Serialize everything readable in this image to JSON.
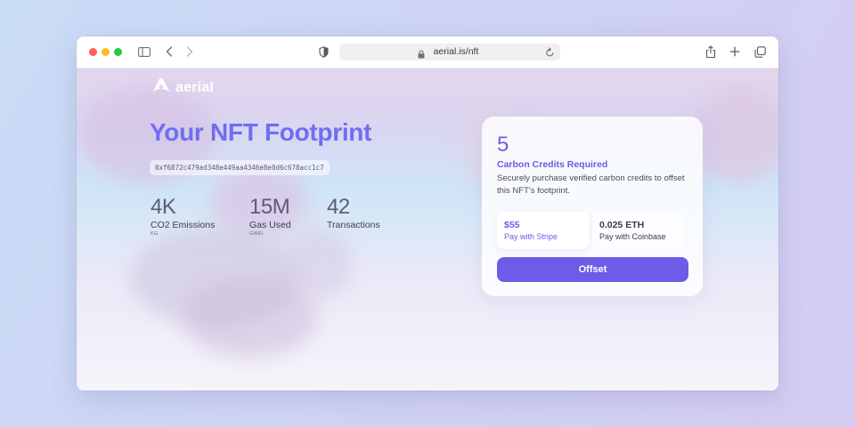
{
  "browser": {
    "url": "aerial.is/nft",
    "icons": [
      "sidebar-icon",
      "back-icon",
      "forward-icon",
      "shield-icon",
      "lock-icon",
      "reload-icon",
      "share-icon",
      "new-tab-icon",
      "tabs-icon"
    ]
  },
  "brand": {
    "name": "aerial"
  },
  "page": {
    "title": "Your NFT Footprint",
    "wallet_hash": "0xf6872c479ad348e449aa4346e8e0d6c678acc1c7",
    "stats": [
      {
        "value": "4K",
        "label": "CO2 Emissions",
        "unit": "KG"
      },
      {
        "value": "15M",
        "label": "Gas Used",
        "unit": "GWEI"
      },
      {
        "value": "42",
        "label": "Transactions",
        "unit": ""
      }
    ]
  },
  "card": {
    "credits": "5",
    "credits_label": "Carbon Credits Required",
    "description": "Securely purchase verified carbon credits to offset this NFT's footprint.",
    "options": [
      {
        "amount": "$55",
        "method": "Pay with Stripe"
      },
      {
        "amount": "0.025 ETH",
        "method": "Pay with Coinbase"
      }
    ],
    "button_label": "Offset"
  },
  "colors": {
    "accent": "#6c5ce7",
    "title": "#6f6ef2"
  }
}
